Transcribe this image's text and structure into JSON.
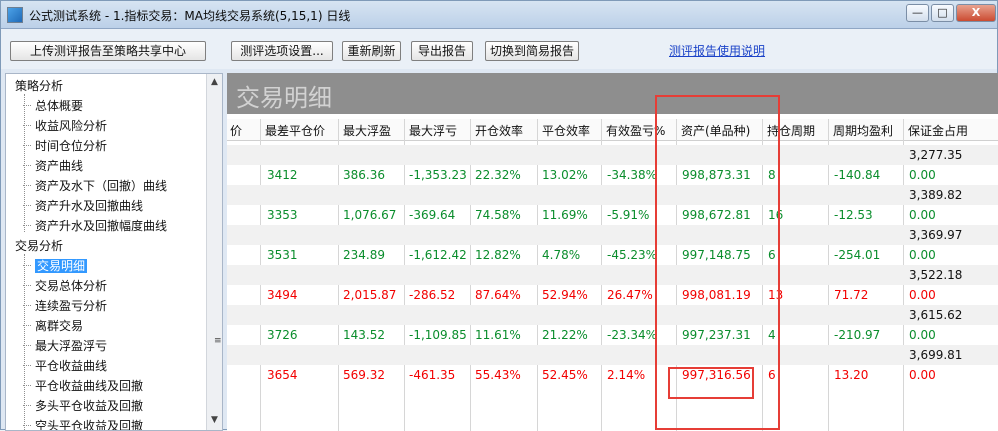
{
  "window": {
    "title": "公式测试系统 - 1.指标交易：MA均线交易系统(5,15,1) 日线",
    "controls": [
      "—",
      "□",
      "X"
    ]
  },
  "toolbar": {
    "upload_label": "上传测评报告至策略共享中心",
    "settings_label": "测评选项设置...",
    "refresh_label": "重新刷新",
    "export_label": "导出报告",
    "switch_label": "切换到简易报告",
    "help_link": "测评报告使用说明"
  },
  "tree": {
    "groups": [
      {
        "label": "策略分析",
        "items": [
          "总体概要",
          "收益风险分析",
          "时间仓位分析",
          "资产曲线",
          "资产及水下（回撤）曲线",
          "资产升水及回撤曲线",
          "资产升水及回撤幅度曲线"
        ]
      },
      {
        "label": "交易分析",
        "items": [
          "交易明细",
          "交易总体分析",
          "连续盈亏分析",
          "离群交易",
          "最大浮盈浮亏",
          "平仓收益曲线",
          "平仓收益曲线及回撤",
          "多头平仓收益及回撤",
          "空头平仓收益及回撤"
        ]
      }
    ],
    "selected": "交易明细"
  },
  "main": {
    "panel_title": "交易明细",
    "columns": [
      "价",
      "最差平仓价",
      "最大浮盈",
      "最大浮亏",
      "开仓效率",
      "平仓效率",
      "有效盈亏%",
      "资产(单品种)",
      "持仓周期",
      "周期均盈利",
      "保证金占用"
    ],
    "rows": [
      {
        "margin": "3,277.35"
      },
      {
        "worst": "3412",
        "max_float_profit": "386.36",
        "max_float_loss": "-1,353.23",
        "open_eff": "22.32%",
        "close_eff": "13.02%",
        "effective": "-34.38%",
        "asset": "998,873.31",
        "hold": "8",
        "avg_profit": "-140.84",
        "margin": "0.00",
        "color": "green"
      },
      {
        "margin": "3,389.82"
      },
      {
        "worst": "3353",
        "max_float_profit": "1,076.67",
        "max_float_loss": "-369.64",
        "open_eff": "74.58%",
        "close_eff": "11.69%",
        "effective": "-5.91%",
        "asset": "998,672.81",
        "hold": "16",
        "avg_profit": "-12.53",
        "margin": "0.00",
        "color": "green"
      },
      {
        "margin": "3,369.97"
      },
      {
        "worst": "3531",
        "max_float_profit": "234.89",
        "max_float_loss": "-1,612.42",
        "open_eff": "12.82%",
        "close_eff": "4.78%",
        "effective": "-45.23%",
        "asset": "997,148.75",
        "hold": "6",
        "avg_profit": "-254.01",
        "margin": "0.00",
        "color": "green"
      },
      {
        "margin": "3,522.18"
      },
      {
        "worst": "3494",
        "max_float_profit": "2,015.87",
        "max_float_loss": "-286.52",
        "open_eff": "87.64%",
        "close_eff": "52.94%",
        "effective": "26.47%",
        "asset": "998,081.19",
        "hold": "13",
        "avg_profit": "71.72",
        "margin": "0.00",
        "color": "red"
      },
      {
        "margin": "3,615.62"
      },
      {
        "worst": "3726",
        "max_float_profit": "143.52",
        "max_float_loss": "-1,109.85",
        "open_eff": "11.61%",
        "close_eff": "21.22%",
        "effective": "-23.34%",
        "asset": "997,237.31",
        "hold": "4",
        "avg_profit": "-210.97",
        "margin": "0.00",
        "color": "green"
      },
      {
        "margin": "3,699.81"
      },
      {
        "worst": "3654",
        "max_float_profit": "569.32",
        "max_float_loss": "-461.35",
        "open_eff": "55.43%",
        "close_eff": "52.45%",
        "effective": "2.14%",
        "asset": "997,316.56",
        "hold": "6",
        "avg_profit": "13.20",
        "margin": "0.00",
        "color": "red"
      }
    ]
  },
  "colors": {
    "positive": "#f20000",
    "negative": "#0a8d2c",
    "highlight_box": "#e63d36",
    "banner": "#8e8e8e"
  }
}
